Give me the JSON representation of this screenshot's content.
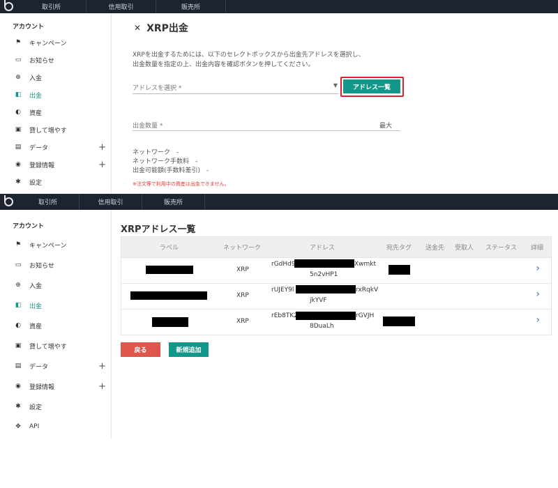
{
  "top_nav": [
    "取引所",
    "信用取引",
    "販売所"
  ],
  "sidebar": {
    "heading": "アカウント",
    "items": [
      {
        "label": "キャンペーン",
        "icon": "flag-icon",
        "glyph": "⚑"
      },
      {
        "label": "お知らせ",
        "icon": "message-icon",
        "glyph": "▭"
      },
      {
        "label": "入金",
        "icon": "plus-circle-icon",
        "glyph": "⊕"
      },
      {
        "label": "出金",
        "icon": "wallet-icon",
        "glyph": "◧"
      },
      {
        "label": "資産",
        "icon": "pie-chart-icon",
        "glyph": "◐"
      },
      {
        "label": "貸して増やす",
        "icon": "lend-icon",
        "glyph": "▣"
      },
      {
        "label": "データ",
        "icon": "clipboard-icon",
        "glyph": "▤"
      },
      {
        "label": "登録情報",
        "icon": "account-icon",
        "glyph": "◉"
      },
      {
        "label": "設定",
        "icon": "gear-icon",
        "glyph": "✱"
      },
      {
        "label": "API",
        "icon": "api-icon",
        "glyph": "✥"
      }
    ],
    "expand_glyph": "+"
  },
  "withdraw": {
    "title": "XRP出金",
    "xrp_glyph": "✕",
    "description_line1": "XRPを出金するためには、以下のセレクトボックスから出金先アドレスを選択し、",
    "description_line2": "出金数量を指定の上、出金内容を確認ボタンを押してください。",
    "address_select_placeholder": "アドレスを選択 *",
    "select_caret": "▼",
    "address_list_button": "アドレス一覧",
    "amount_placeholder": "出金数量 *",
    "max_label": "最大",
    "network_line": "ネットワーク　-",
    "fee_line": "ネットワーク手数料　-",
    "available_line": "出金可能額(手数料差引)　-",
    "warning": "※注文等で利用中の資産は出金できません。"
  },
  "address_list": {
    "title": "XRPアドレス一覧",
    "columns": [
      "ラベル",
      "ネットワーク",
      "アドレス",
      "宛先タグ",
      "送金先",
      "受取人",
      "ステータス",
      "詳細"
    ],
    "rows": [
      {
        "network": "XRP",
        "address_start": "rGdHd9",
        "address_end": "Xwmkt",
        "address_line2": "5n2vHP1"
      },
      {
        "network": "XRP",
        "address_start": "rUJEY9l",
        "address_end": "rxRqkV",
        "address_line2": "jkYVF"
      },
      {
        "network": "XRP",
        "address_start": "rEb8TK2",
        "address_end": "rGVJH",
        "address_line2": "8DuaLh"
      }
    ],
    "chevron_glyph": "›",
    "back_button": "戻る",
    "new_button": "新規追加"
  }
}
